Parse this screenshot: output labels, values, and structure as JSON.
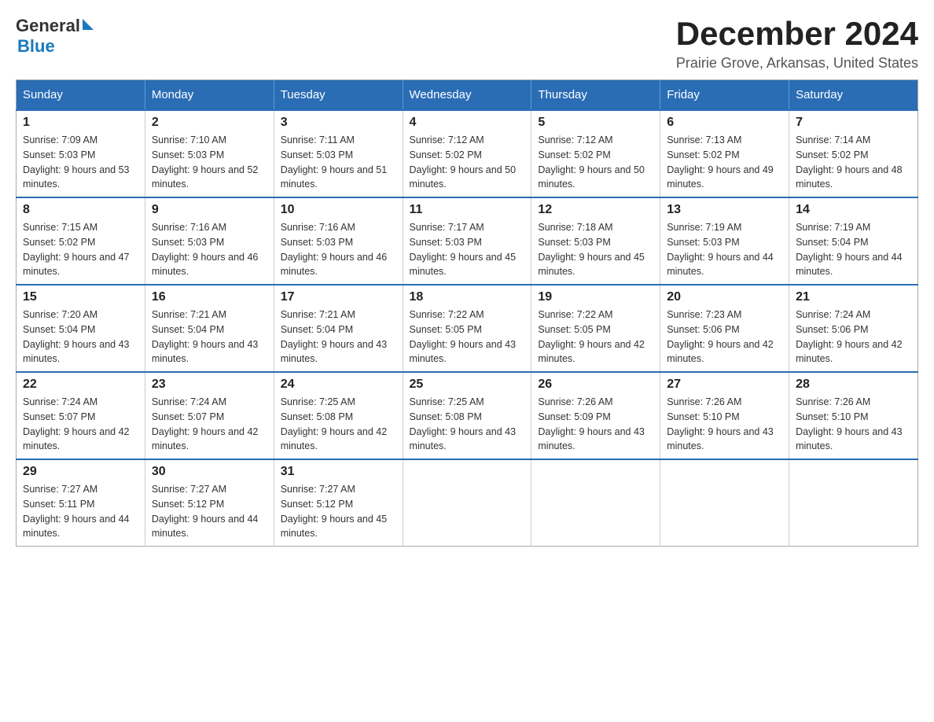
{
  "header": {
    "logo": {
      "general": "General",
      "blue": "Blue",
      "alt": "GeneralBlue logo"
    },
    "title": "December 2024",
    "subtitle": "Prairie Grove, Arkansas, United States"
  },
  "calendar": {
    "days_of_week": [
      "Sunday",
      "Monday",
      "Tuesday",
      "Wednesday",
      "Thursday",
      "Friday",
      "Saturday"
    ],
    "weeks": [
      [
        {
          "day": "1",
          "sunrise": "Sunrise: 7:09 AM",
          "sunset": "Sunset: 5:03 PM",
          "daylight": "Daylight: 9 hours and 53 minutes."
        },
        {
          "day": "2",
          "sunrise": "Sunrise: 7:10 AM",
          "sunset": "Sunset: 5:03 PM",
          "daylight": "Daylight: 9 hours and 52 minutes."
        },
        {
          "day": "3",
          "sunrise": "Sunrise: 7:11 AM",
          "sunset": "Sunset: 5:03 PM",
          "daylight": "Daylight: 9 hours and 51 minutes."
        },
        {
          "day": "4",
          "sunrise": "Sunrise: 7:12 AM",
          "sunset": "Sunset: 5:02 PM",
          "daylight": "Daylight: 9 hours and 50 minutes."
        },
        {
          "day": "5",
          "sunrise": "Sunrise: 7:12 AM",
          "sunset": "Sunset: 5:02 PM",
          "daylight": "Daylight: 9 hours and 50 minutes."
        },
        {
          "day": "6",
          "sunrise": "Sunrise: 7:13 AM",
          "sunset": "Sunset: 5:02 PM",
          "daylight": "Daylight: 9 hours and 49 minutes."
        },
        {
          "day": "7",
          "sunrise": "Sunrise: 7:14 AM",
          "sunset": "Sunset: 5:02 PM",
          "daylight": "Daylight: 9 hours and 48 minutes."
        }
      ],
      [
        {
          "day": "8",
          "sunrise": "Sunrise: 7:15 AM",
          "sunset": "Sunset: 5:02 PM",
          "daylight": "Daylight: 9 hours and 47 minutes."
        },
        {
          "day": "9",
          "sunrise": "Sunrise: 7:16 AM",
          "sunset": "Sunset: 5:03 PM",
          "daylight": "Daylight: 9 hours and 46 minutes."
        },
        {
          "day": "10",
          "sunrise": "Sunrise: 7:16 AM",
          "sunset": "Sunset: 5:03 PM",
          "daylight": "Daylight: 9 hours and 46 minutes."
        },
        {
          "day": "11",
          "sunrise": "Sunrise: 7:17 AM",
          "sunset": "Sunset: 5:03 PM",
          "daylight": "Daylight: 9 hours and 45 minutes."
        },
        {
          "day": "12",
          "sunrise": "Sunrise: 7:18 AM",
          "sunset": "Sunset: 5:03 PM",
          "daylight": "Daylight: 9 hours and 45 minutes."
        },
        {
          "day": "13",
          "sunrise": "Sunrise: 7:19 AM",
          "sunset": "Sunset: 5:03 PM",
          "daylight": "Daylight: 9 hours and 44 minutes."
        },
        {
          "day": "14",
          "sunrise": "Sunrise: 7:19 AM",
          "sunset": "Sunset: 5:04 PM",
          "daylight": "Daylight: 9 hours and 44 minutes."
        }
      ],
      [
        {
          "day": "15",
          "sunrise": "Sunrise: 7:20 AM",
          "sunset": "Sunset: 5:04 PM",
          "daylight": "Daylight: 9 hours and 43 minutes."
        },
        {
          "day": "16",
          "sunrise": "Sunrise: 7:21 AM",
          "sunset": "Sunset: 5:04 PM",
          "daylight": "Daylight: 9 hours and 43 minutes."
        },
        {
          "day": "17",
          "sunrise": "Sunrise: 7:21 AM",
          "sunset": "Sunset: 5:04 PM",
          "daylight": "Daylight: 9 hours and 43 minutes."
        },
        {
          "day": "18",
          "sunrise": "Sunrise: 7:22 AM",
          "sunset": "Sunset: 5:05 PM",
          "daylight": "Daylight: 9 hours and 43 minutes."
        },
        {
          "day": "19",
          "sunrise": "Sunrise: 7:22 AM",
          "sunset": "Sunset: 5:05 PM",
          "daylight": "Daylight: 9 hours and 42 minutes."
        },
        {
          "day": "20",
          "sunrise": "Sunrise: 7:23 AM",
          "sunset": "Sunset: 5:06 PM",
          "daylight": "Daylight: 9 hours and 42 minutes."
        },
        {
          "day": "21",
          "sunrise": "Sunrise: 7:24 AM",
          "sunset": "Sunset: 5:06 PM",
          "daylight": "Daylight: 9 hours and 42 minutes."
        }
      ],
      [
        {
          "day": "22",
          "sunrise": "Sunrise: 7:24 AM",
          "sunset": "Sunset: 5:07 PM",
          "daylight": "Daylight: 9 hours and 42 minutes."
        },
        {
          "day": "23",
          "sunrise": "Sunrise: 7:24 AM",
          "sunset": "Sunset: 5:07 PM",
          "daylight": "Daylight: 9 hours and 42 minutes."
        },
        {
          "day": "24",
          "sunrise": "Sunrise: 7:25 AM",
          "sunset": "Sunset: 5:08 PM",
          "daylight": "Daylight: 9 hours and 42 minutes."
        },
        {
          "day": "25",
          "sunrise": "Sunrise: 7:25 AM",
          "sunset": "Sunset: 5:08 PM",
          "daylight": "Daylight: 9 hours and 43 minutes."
        },
        {
          "day": "26",
          "sunrise": "Sunrise: 7:26 AM",
          "sunset": "Sunset: 5:09 PM",
          "daylight": "Daylight: 9 hours and 43 minutes."
        },
        {
          "day": "27",
          "sunrise": "Sunrise: 7:26 AM",
          "sunset": "Sunset: 5:10 PM",
          "daylight": "Daylight: 9 hours and 43 minutes."
        },
        {
          "day": "28",
          "sunrise": "Sunrise: 7:26 AM",
          "sunset": "Sunset: 5:10 PM",
          "daylight": "Daylight: 9 hours and 43 minutes."
        }
      ],
      [
        {
          "day": "29",
          "sunrise": "Sunrise: 7:27 AM",
          "sunset": "Sunset: 5:11 PM",
          "daylight": "Daylight: 9 hours and 44 minutes."
        },
        {
          "day": "30",
          "sunrise": "Sunrise: 7:27 AM",
          "sunset": "Sunset: 5:12 PM",
          "daylight": "Daylight: 9 hours and 44 minutes."
        },
        {
          "day": "31",
          "sunrise": "Sunrise: 7:27 AM",
          "sunset": "Sunset: 5:12 PM",
          "daylight": "Daylight: 9 hours and 45 minutes."
        },
        null,
        null,
        null,
        null
      ]
    ]
  }
}
